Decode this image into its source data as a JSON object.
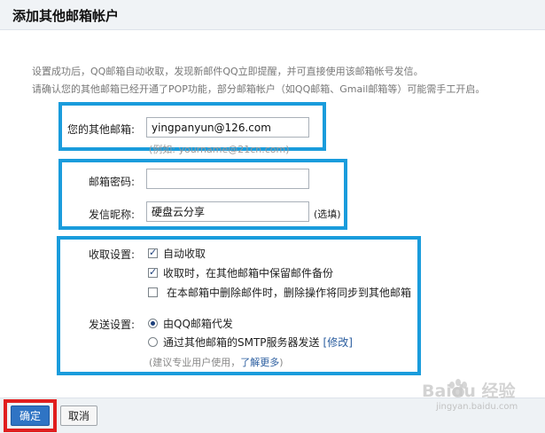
{
  "header": {
    "title": "添加其他邮箱帐户"
  },
  "intro": {
    "line1": "设置成功后，QQ邮箱自动收取，发现新邮件QQ立即提醒，并可直接使用该邮箱帐号发信。",
    "line2": "请确认您的其他邮箱已经开通了POP功能，部分邮箱帐户（如QQ邮箱、Gmail邮箱等）可能需手工开启。"
  },
  "email": {
    "label": "您的其他邮箱:",
    "value": "yingpanyun@126.com",
    "hint": "(例如: yourname@21cn.com)"
  },
  "password": {
    "label": "邮箱密码:",
    "value": ""
  },
  "nickname": {
    "label": "发信昵称:",
    "value": "硬盘云分享",
    "optional": "(选填)"
  },
  "receive": {
    "label": "收取设置:",
    "options": [
      {
        "text": "自动收取",
        "checked": true
      },
      {
        "text": "收取时，在其他邮箱中保留邮件备份",
        "checked": true
      },
      {
        "text": "在本邮箱中删除邮件时，删除操作将同步到其他邮箱",
        "checked": false
      }
    ]
  },
  "send": {
    "label": "发送设置:",
    "options": [
      {
        "text": "由QQ邮箱代发",
        "checked": true
      },
      {
        "text": "通过其他邮箱的SMTP服务器发送",
        "link": "[修改]",
        "checked": false
      }
    ],
    "note_prefix": "(建议专业用户使用，",
    "note_link": "了解更多",
    "note_suffix": ")"
  },
  "footer": {
    "ok_label": "确定",
    "cancel_label": "取消"
  },
  "watermark": {
    "main": "Baidu 经验",
    "sub": "jingyan.baidu.com"
  },
  "colors": {
    "highlight_box": "#1a9cdc",
    "highlight_red": "#e01e1e",
    "primary_button": "#2f74c4"
  }
}
